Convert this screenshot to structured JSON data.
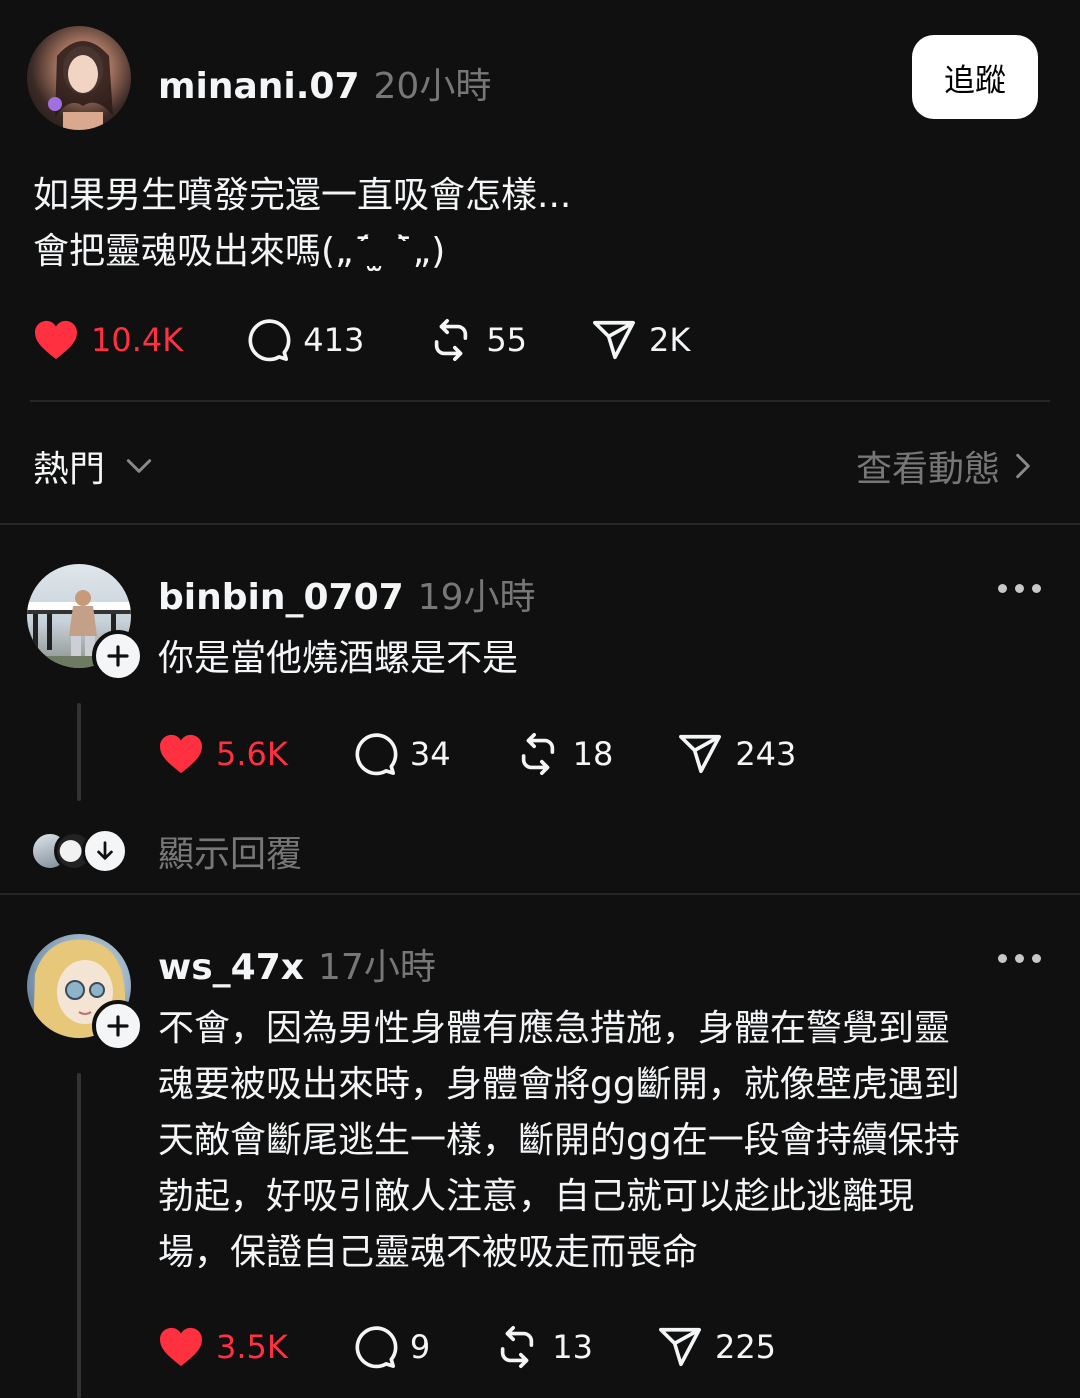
{
  "post": {
    "username": "minani.07",
    "time": "20小時",
    "follow_label": "追蹤",
    "text_lines": [
      "如果男生噴發完還一直吸會怎樣...",
      "會把靈魂吸出來嗎(„ˊ̄ ̫ ˋ̄„)"
    ],
    "likes": "10.4K",
    "comments": "413",
    "reposts": "55",
    "shares": "2K"
  },
  "sort": {
    "label": "熱門",
    "activity_label": "查看動態"
  },
  "replies": [
    {
      "username": "binbin_0707",
      "time": "19小時",
      "text": "你是當他燒酒螺是不是",
      "likes": "5.6K",
      "comments": "34",
      "reposts": "18",
      "shares": "243",
      "show_replies_label": "顯示回覆"
    },
    {
      "username": "ws_47x",
      "time": "17小時",
      "text_lines": [
        "不會，因為男性身體有應急措施，身體在警覺到靈",
        "魂要被吸出來時，身體會將gg斷開，就像壁虎遇到",
        "天敵會斷尾逃生一樣，斷開的gg在一段會持續保持",
        "勃起，好吸引敵人注意，自己就可以趁此逃離現",
        "場，保證自己靈魂不被吸走而喪命"
      ],
      "likes": "3.5K",
      "comments": "9",
      "reposts": "13",
      "shares": "225"
    }
  ],
  "colors": {
    "background": "#101010",
    "liked": "#ff3040",
    "muted": "#777777",
    "divider": "#262626"
  },
  "icons": [
    "heart-icon",
    "comment-icon",
    "repost-icon",
    "share-icon",
    "chevron-down-icon",
    "chevron-right-icon",
    "more-icon",
    "plus-icon",
    "arrow-down-icon"
  ]
}
